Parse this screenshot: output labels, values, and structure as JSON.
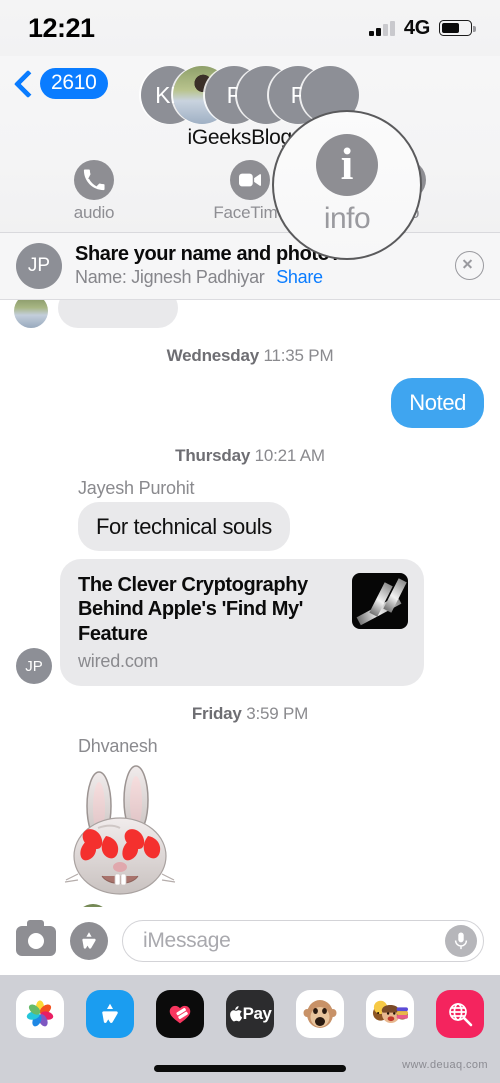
{
  "status_bar": {
    "time": "12:21",
    "network": "4G",
    "signal_bars_filled": 2,
    "signal_bars_total": 4,
    "battery_percent": 62
  },
  "nav": {
    "back_badge": "2610",
    "back_icon": "chevron-left-icon",
    "thread_title": "iGeeksBlog",
    "avatars": [
      {
        "initials": "KB",
        "type": "initials"
      },
      {
        "initials": "",
        "type": "photo"
      },
      {
        "initials": "P",
        "type": "initials"
      },
      {
        "initials": "",
        "type": "initials"
      },
      {
        "initials": "P",
        "type": "initials"
      },
      {
        "initials": "",
        "type": "initials"
      }
    ],
    "actions": [
      {
        "label": "audio",
        "icon": "phone-icon"
      },
      {
        "label": "FaceTime",
        "icon": "video-camera-icon"
      },
      {
        "label": "info",
        "icon": "info-icon"
      }
    ]
  },
  "magnifier": {
    "target_label": "info",
    "target_glyph": "i",
    "border_color": "#5a5a5c"
  },
  "share_banner": {
    "avatar_initials": "JP",
    "title": "Share your name and photo?",
    "name_label": "Name: Jignesh Padhiyar",
    "share_link": "Share",
    "close_icon": "close-circle-icon"
  },
  "thread": {
    "separators": {
      "wednesday_day": "Wednesday",
      "wednesday_time": "11:35 PM",
      "thursday_day": "Thursday",
      "thursday_time": "10:21 AM",
      "friday_day": "Friday",
      "friday_time": "3:59 PM"
    },
    "outgoing_noted": "Noted",
    "sender_jayesh": "Jayesh Purohit",
    "incoming_technical": "For technical souls",
    "link_preview": {
      "avatar_initials": "JP",
      "title": "The Clever Cryptography Behind Apple's 'Find My' Feature",
      "domain": "wired.com",
      "thumbnail_icon": "wired-logo-icon"
    },
    "sender_dhvanesh": "Dhvanesh",
    "memoji": {
      "icon": "bunny-heart-eyes-memoji",
      "emoji": "🐰"
    }
  },
  "input_bar": {
    "camera_icon": "camera-icon",
    "appstore_icon": "app-store-icon",
    "placeholder": "iMessage",
    "value": "",
    "mic_icon": "microphone-icon"
  },
  "app_drawer": {
    "items": [
      {
        "name": "photos",
        "icon": "photos-icon",
        "glyph": ""
      },
      {
        "name": "app-store",
        "icon": "app-store-icon",
        "glyph": ""
      },
      {
        "name": "digital-touch",
        "icon": "digital-touch-icon",
        "glyph": ""
      },
      {
        "name": "apple-pay",
        "icon": "apple-pay-icon",
        "glyph": "Pay"
      },
      {
        "name": "animoji",
        "icon": "animoji-icon",
        "glyph": "🐵"
      },
      {
        "name": "memoji",
        "icon": "memoji-icon",
        "glyph": "🧑"
      },
      {
        "name": "images",
        "icon": "images-search-icon",
        "glyph": ""
      }
    ]
  },
  "footer": {
    "watermark": "www.deuaq.com",
    "home_indicator": "home-indicator"
  },
  "colors": {
    "imessage_blue": "#3fa5f0",
    "link_blue": "#0a7cff",
    "bubble_gray": "#e9e9eb",
    "chrome_gray": "#8e8e93"
  }
}
